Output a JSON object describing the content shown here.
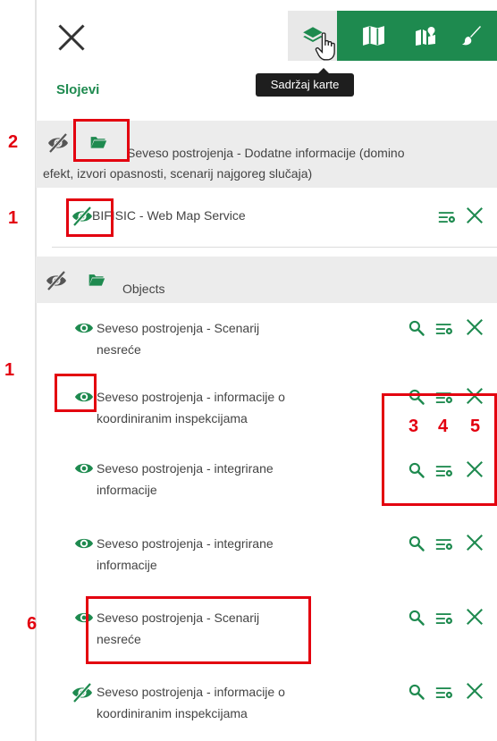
{
  "tooltip": {
    "toolbar_layers": "Sadržaj karte"
  },
  "panel": {
    "title": "Slojevi"
  },
  "groups": [
    {
      "label_line1": "Seveso postrojenja - Dodatne informacije (domino",
      "label_line2": "efekt, izvori opasnosti, scenarij najgoreg slučaja)"
    },
    {
      "label": "Objects"
    }
  ],
  "layers": [
    {
      "line1": "BIFISIC - Web Map Service",
      "line2": ""
    },
    {
      "line1": "Seveso postrojenja - Scenarij",
      "line2": "nesreće"
    },
    {
      "line1": "Seveso postrojenja - informacije o",
      "line2": "koordiniranim inspekcijama"
    },
    {
      "line1": "Seveso postrojenja - integrirane",
      "line2": "informacije"
    },
    {
      "line1": "Seveso postrojenja - integrirane",
      "line2": "informacije"
    },
    {
      "line1": "Seveso postrojenja - Scenarij",
      "line2": "nesreće"
    },
    {
      "line1": "Seveso postrojenja - informacije o",
      "line2": "koordiniranim inspekcijama"
    }
  ],
  "annotations": {
    "n1": "1",
    "n2": "2",
    "n3": "3",
    "n4": "4",
    "n5": "5",
    "n6": "6"
  },
  "colors": {
    "brand_green": "#1e8a4f",
    "annotation_red": "#e3000f",
    "group_bg": "#ececec"
  }
}
